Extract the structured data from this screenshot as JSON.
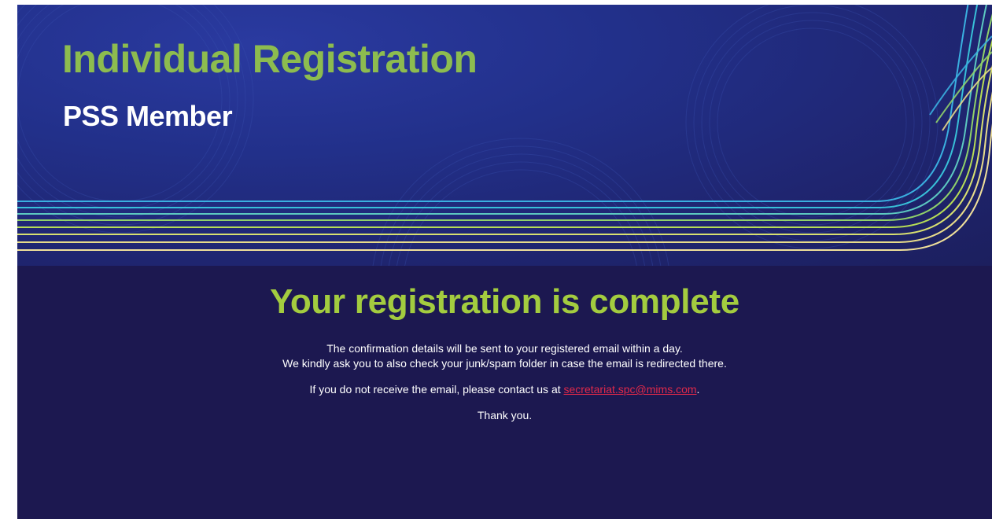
{
  "banner": {
    "title": "Individual Registration",
    "subtitle": "PSS Member"
  },
  "main": {
    "heading": "Your registration is complete",
    "confirmation_line1": "The confirmation details will be sent to your registered email within a day.",
    "confirmation_line2": "We kindly ask you to also check your junk/spam folder in case the email is redirected there.",
    "contact_prefix": "If you do not receive the email, please contact us at ",
    "contact_email": "secretariat.spc@mims.com",
    "contact_suffix": ".",
    "thanks": "Thank you."
  },
  "colors": {
    "background": "#1c1850",
    "title_green": "#8dbc4f",
    "heading_green": "#a3cc3f",
    "link_red": "#e0294a"
  }
}
